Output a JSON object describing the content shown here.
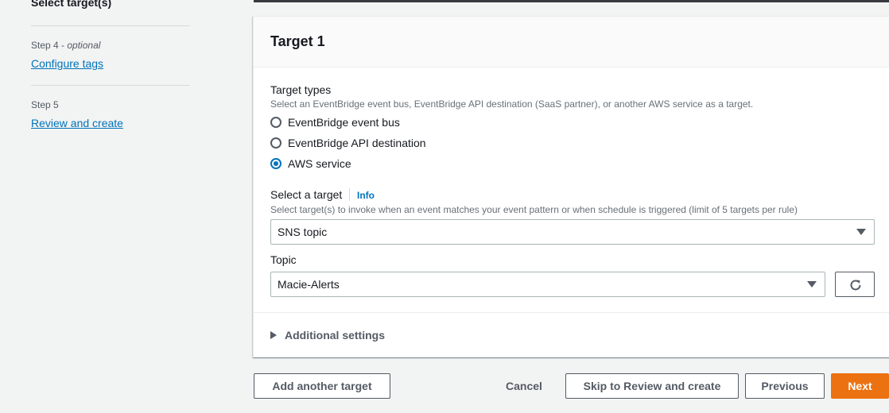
{
  "sidebar": {
    "current_step_label": "Select target(s)",
    "steps": [
      {
        "step": "Step 4",
        "suffix": "optional",
        "link": "Configure tags"
      },
      {
        "step": "Step 5",
        "suffix": "",
        "link": "Review and create"
      }
    ]
  },
  "card": {
    "title": "Target 1",
    "target_types": {
      "label": "Target types",
      "description": "Select an EventBridge event bus, EventBridge API destination (SaaS partner), or another AWS service as a target.",
      "options": [
        "EventBridge event bus",
        "EventBridge API destination",
        "AWS service"
      ],
      "selected": "AWS service"
    },
    "select_target": {
      "label": "Select a target",
      "info": "Info",
      "description": "Select target(s) to invoke when an event matches your event pattern or when schedule is triggered (limit of 5 targets per rule)",
      "value": "SNS topic"
    },
    "topic": {
      "label": "Topic",
      "value": "Macie-Alerts"
    },
    "additional_settings": "Additional settings"
  },
  "actions": {
    "add_target": "Add another target",
    "cancel": "Cancel",
    "skip": "Skip to Review and create",
    "previous": "Previous",
    "next": "Next"
  },
  "colors": {
    "accent": "#0073bb",
    "primary_button": "#ec7211",
    "background": "#f2f3f3"
  },
  "icons": [
    "caret-down-icon",
    "refresh-icon",
    "expand-triangle-icon"
  ]
}
